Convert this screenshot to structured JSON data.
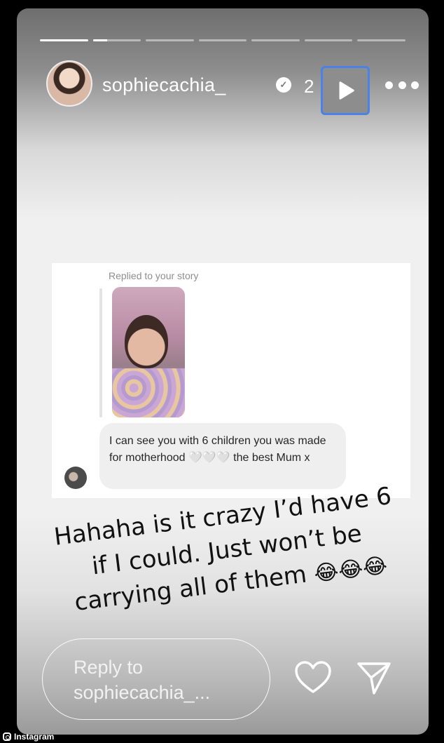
{
  "story": {
    "progress": [
      1,
      0.3,
      0,
      0,
      0,
      0,
      0
    ],
    "header": {
      "username": "sophiecachia_",
      "verified_icon": "verified-badge-icon",
      "time_fragment": "2",
      "play_icon": "play-icon",
      "more_icon": "more-options-icon"
    },
    "card": {
      "replied_label": "Replied to your story",
      "message": "I can see you with 6 children you was made for motherhood 🤍🤍🤍 the best Mum x"
    },
    "caption": {
      "line1": "Hahaha is it crazy I’d have 6",
      "line2": "if I could. Just won’t be",
      "line3": "carrying all of them",
      "emoji": "😂😂😂"
    },
    "reply": {
      "placeholder": "Reply to\nsophiecachia_...",
      "like_icon": "heart-icon",
      "send_icon": "send-icon"
    }
  },
  "watermark": {
    "label": "Instagram",
    "icon": "instagram-icon"
  }
}
